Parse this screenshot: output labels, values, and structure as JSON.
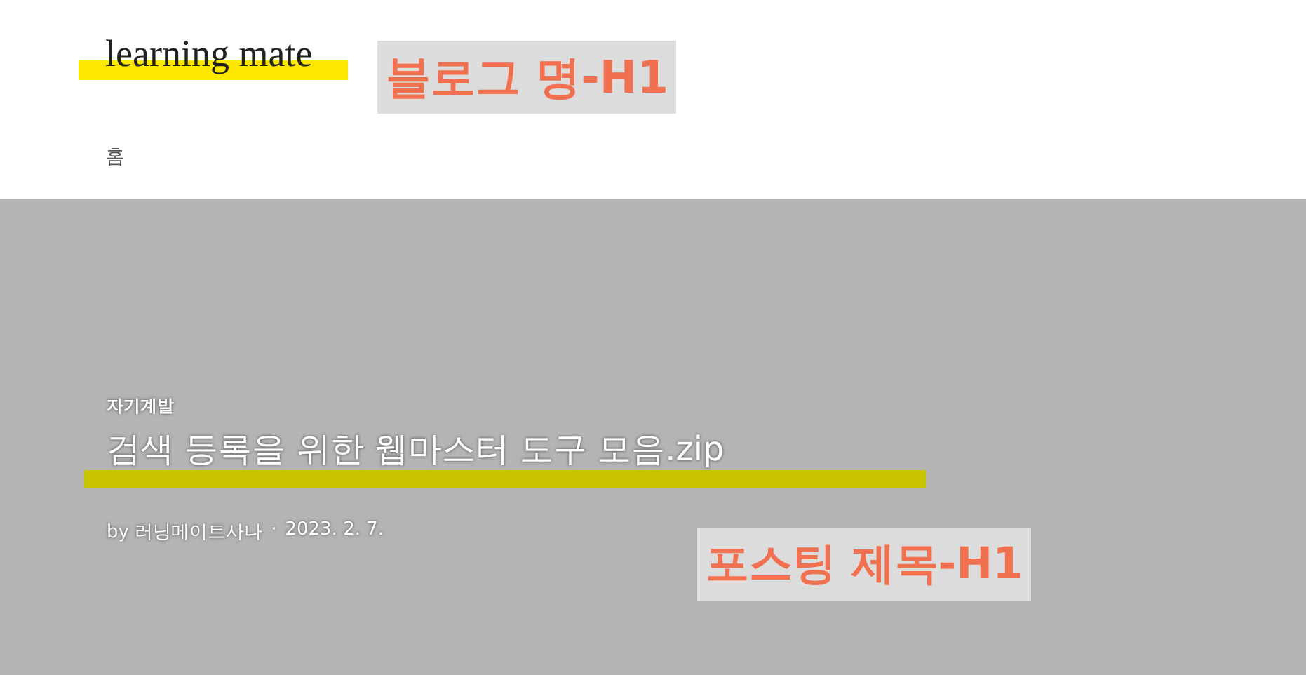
{
  "header": {
    "blog_title": "learning mate",
    "nav": [
      {
        "label": "홈"
      }
    ],
    "annotation": "블로그 명-H1"
  },
  "post": {
    "category": "자기계발",
    "title": "검색 등록을 위한 웹마스터 도구 모음.zip",
    "author": "by 러닝메이트사나",
    "separator": "·",
    "date": "2023. 2. 7.",
    "annotation": "포스팅 제목-H1"
  }
}
